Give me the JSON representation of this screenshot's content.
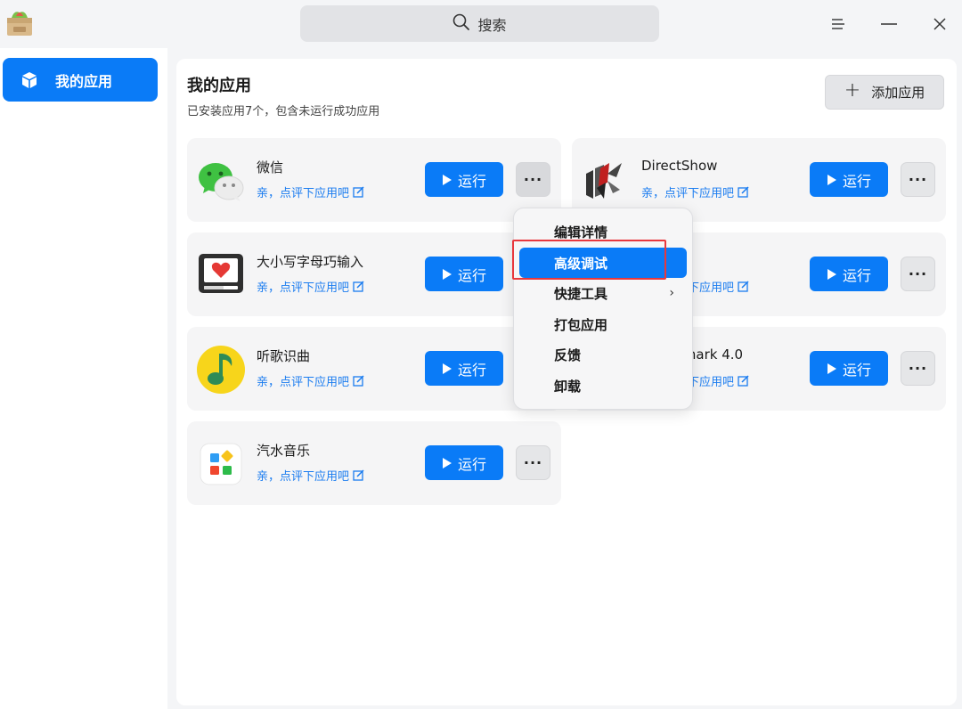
{
  "colors": {
    "accent": "#0a7bf7",
    "link": "#1a7cf0",
    "highlight": "#e8383d"
  },
  "titlebar": {
    "search_label": "搜索",
    "search_icon": "search-icon",
    "menu_icon": "hamburger-icon",
    "minimize_icon": "minimize-icon",
    "close_icon": "close-icon"
  },
  "sidebar": {
    "items": [
      {
        "label": "我的应用",
        "icon": "cube-icon",
        "selected": true
      }
    ]
  },
  "main": {
    "title": "我的应用",
    "subtitle": "已安装应用7个，包含未运行成功应用",
    "add_button": {
      "plus": "+",
      "label": "添加应用"
    },
    "cards": [
      {
        "name": "微信",
        "review": "亲，点评下应用吧",
        "run": "运行",
        "more": "···",
        "icon": "wechat-icon"
      },
      {
        "name": "DirectShow",
        "review": "亲，点评下应用吧",
        "run": "运行",
        "more": "···",
        "icon": "directshow-icon"
      },
      {
        "name": "大小写字母巧输入",
        "review": "亲，点评下应用吧",
        "run": "运行",
        "more": "···",
        "icon": "monitor-heart-icon"
      },
      {
        "name": "",
        "review": "亲，点评下应用吧",
        "run": "运行",
        "more": "···",
        "icon": "app-icon"
      },
      {
        "name": "听歌识曲",
        "review": "亲，点评下应用吧",
        "run": "运行",
        "more": "···",
        "icon": "music-note-icon"
      },
      {
        "name": "Benchmark 4.0",
        "review": "亲，点评下应用吧",
        "run": "运行",
        "more": "···",
        "icon": "benchmark-icon"
      },
      {
        "name": "汽水音乐",
        "review": "亲，点评下应用吧",
        "run": "运行",
        "more": "···",
        "icon": "soda-music-icon"
      }
    ]
  },
  "context_menu": {
    "items": [
      {
        "label": "编辑详情"
      },
      {
        "label": "高级调试",
        "selected": true
      },
      {
        "label": "快捷工具",
        "submenu_arrow": "›"
      },
      {
        "label": "打包应用"
      },
      {
        "label": "反馈"
      },
      {
        "label": "卸载"
      }
    ]
  }
}
